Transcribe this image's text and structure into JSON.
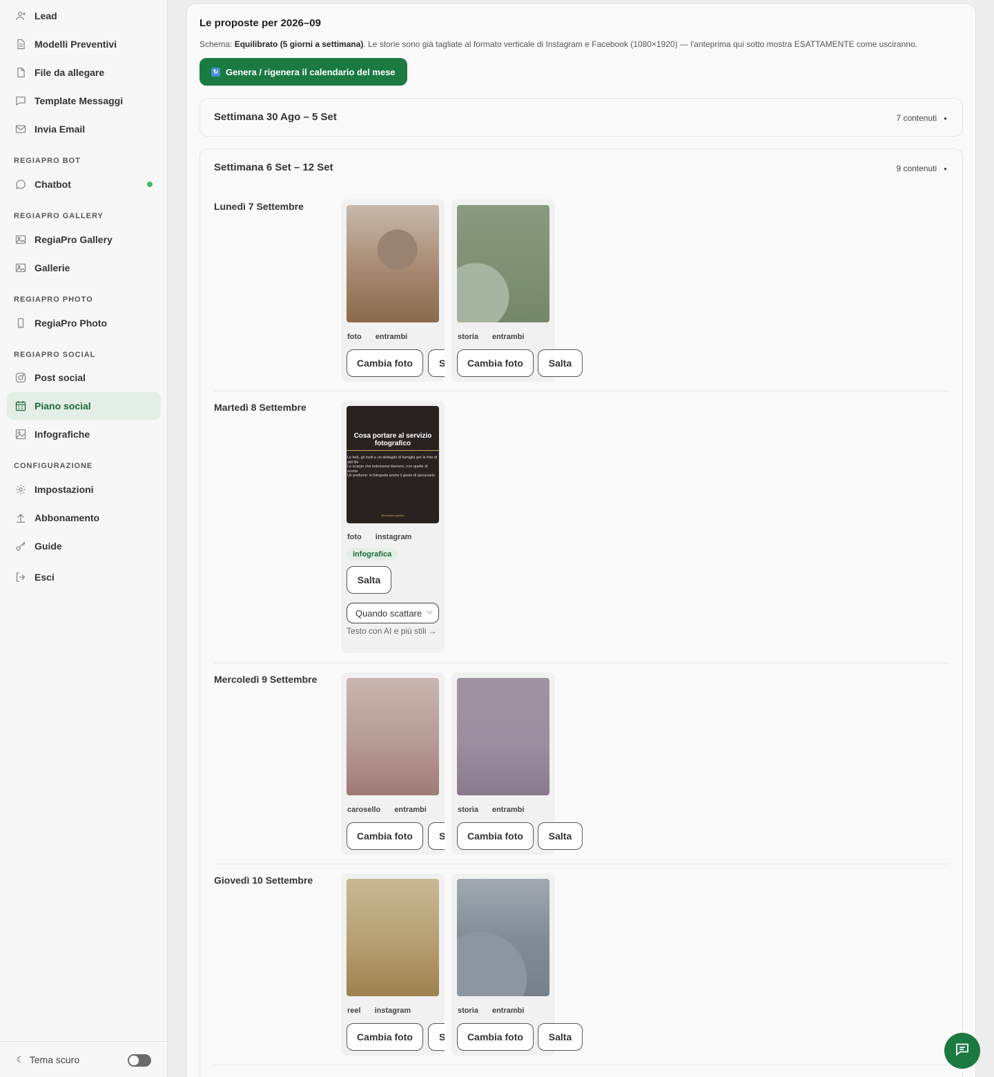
{
  "sidebar": {
    "items": [
      {
        "label": "Lead",
        "icon": "user-plus-icon"
      },
      {
        "label": "Modelli Preventivi",
        "icon": "document-icon"
      },
      {
        "label": "File da allegare",
        "icon": "file-icon"
      },
      {
        "label": "Template Messaggi",
        "icon": "message-icon"
      },
      {
        "label": "Invia Email",
        "icon": "mail-icon"
      },
      {
        "label": "Chatbot",
        "icon": "chat-bubble-icon"
      },
      {
        "label": "RegiaPro Gallery",
        "icon": "image-icon"
      },
      {
        "label": "Gallerie",
        "icon": "image-icon"
      },
      {
        "label": "RegiaPro Photo",
        "icon": "phone-icon"
      },
      {
        "label": "Post social",
        "icon": "instagram-icon"
      },
      {
        "label": "Piano social",
        "icon": "calendar-icon",
        "active": true
      },
      {
        "label": "Infografiche",
        "icon": "image-icon"
      },
      {
        "label": "Impostazioni",
        "icon": "gear-icon"
      },
      {
        "label": "Abbonamento",
        "icon": "upload-icon"
      },
      {
        "label": "Guide",
        "icon": "key-icon"
      },
      {
        "label": "Esci",
        "icon": "logout-icon"
      }
    ],
    "sections": [
      "REGIAPRO BOT",
      "REGIAPRO GALLERY",
      "REGIAPRO PHOTO",
      "REGIAPRO SOCIAL",
      "CONFIGURAZIONE"
    ],
    "chatbot_status_color": "#3dbb6e",
    "dark_theme_label": "Tema scuro",
    "dark_theme_on": false
  },
  "main": {
    "title": "Le proposte per 2026–09",
    "schema_prefix": "Schema: ",
    "schema_value": "Equilibrato (5 giorni a settimana)",
    "schema_suffix": ". Le storie sono già tagliate al formato verticale di Instagram e Facebook (1080×1920) — l'anteprima qui sotto mostra ESATTAMENTE come usciranno.",
    "generate_button": "Genera / rigenera il calendario del mese",
    "accent_color": "#1b7a42"
  },
  "weeks": [
    {
      "title": "Settimana 30 Ago – 5 Set",
      "count": "7 contenuti"
    },
    {
      "title": "Settimana 6 Set – 12 Set",
      "count": "9 contenuti"
    }
  ],
  "days": [
    {
      "label": "Lunedì 7 Settembre",
      "posts": [
        {
          "tags": [
            "foto",
            "entrambi"
          ],
          "btn1": "Cambia foto",
          "btn2": "Salta"
        },
        {
          "tags": [
            "storia",
            "entrambi"
          ],
          "btn1": "Cambia foto",
          "btn2": "Salta"
        }
      ]
    },
    {
      "label": "Martedì 8 Settembre",
      "posts": [
        {
          "tags": [
            "foto",
            "instagram"
          ],
          "badge": "infografica",
          "btn2": "Salta",
          "select": "Quando scattare",
          "ai_link": "Testo con AI e più stili →",
          "infographic": {
            "title": "Cosa portare al servizio fotografico",
            "lines": [
              "Le fedi, gli inviti e un dettaglio di famiglia per le foto di still life",
              "Le scarpe che indosserai davvero, non quelle di scorta",
              "Un profumo: si fotografa anche il gesto di spruzzarlo"
            ],
            "footer": "@studiofotografico"
          }
        }
      ]
    },
    {
      "label": "Mercoledì 9 Settembre",
      "posts": [
        {
          "tags": [
            "carosello",
            "entrambi"
          ],
          "btn1": "Cambia foto",
          "btn2": "Salta"
        },
        {
          "tags": [
            "storia",
            "entrambi"
          ],
          "btn1": "Cambia foto",
          "btn2": "Salta"
        }
      ]
    },
    {
      "label": "Giovedì 10 Settembre",
      "posts": [
        {
          "tags": [
            "reel",
            "instagram"
          ],
          "btn1": "Cambia foto",
          "btn2": "Salta"
        },
        {
          "tags": [
            "storia",
            "entrambi"
          ],
          "btn1": "Cambia foto",
          "btn2": "Salta"
        }
      ]
    }
  ]
}
